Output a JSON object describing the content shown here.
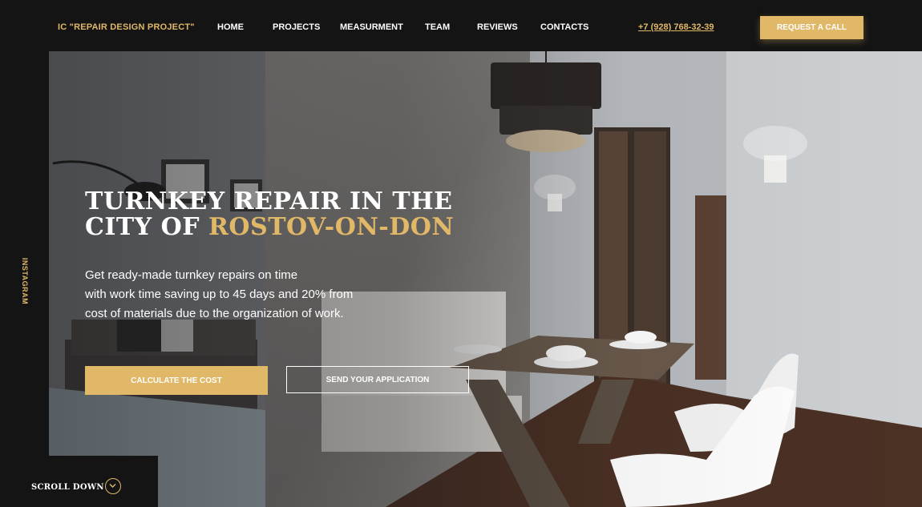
{
  "header": {
    "brand": "IC \"REPAIR DESIGN PROJECT\"",
    "nav": [
      "HOME",
      "PROJECTS",
      "MEASURMENT",
      "TEAM",
      "REVIEWS",
      "CONTACTS"
    ],
    "phone": "+7 (928) 768-32-39",
    "request_button": "REQUEST A CALL"
  },
  "sidebar": {
    "instagram": "INSTAGRAM"
  },
  "hero": {
    "title_line1": "TURNKEY REPAIR IN THE",
    "title_line2_prefix": "CITY OF ",
    "title_line2_accent": "ROSTOV-ON-DON",
    "text_lines": [
      "Get ready-made turnkey repairs on time",
      "with work time saving up to 45 days and 20% from",
      "cost of materials due to the organization of work."
    ],
    "calc_button": "CALCULATE THE COST",
    "application_button": "SEND YOUR APPLICATION"
  },
  "scroll": {
    "label": "SCROLL DOWN",
    "icon": "chevron-down-icon"
  },
  "colors": {
    "accent": "#e1b868",
    "dark": "#141414",
    "white": "#ffffff"
  }
}
